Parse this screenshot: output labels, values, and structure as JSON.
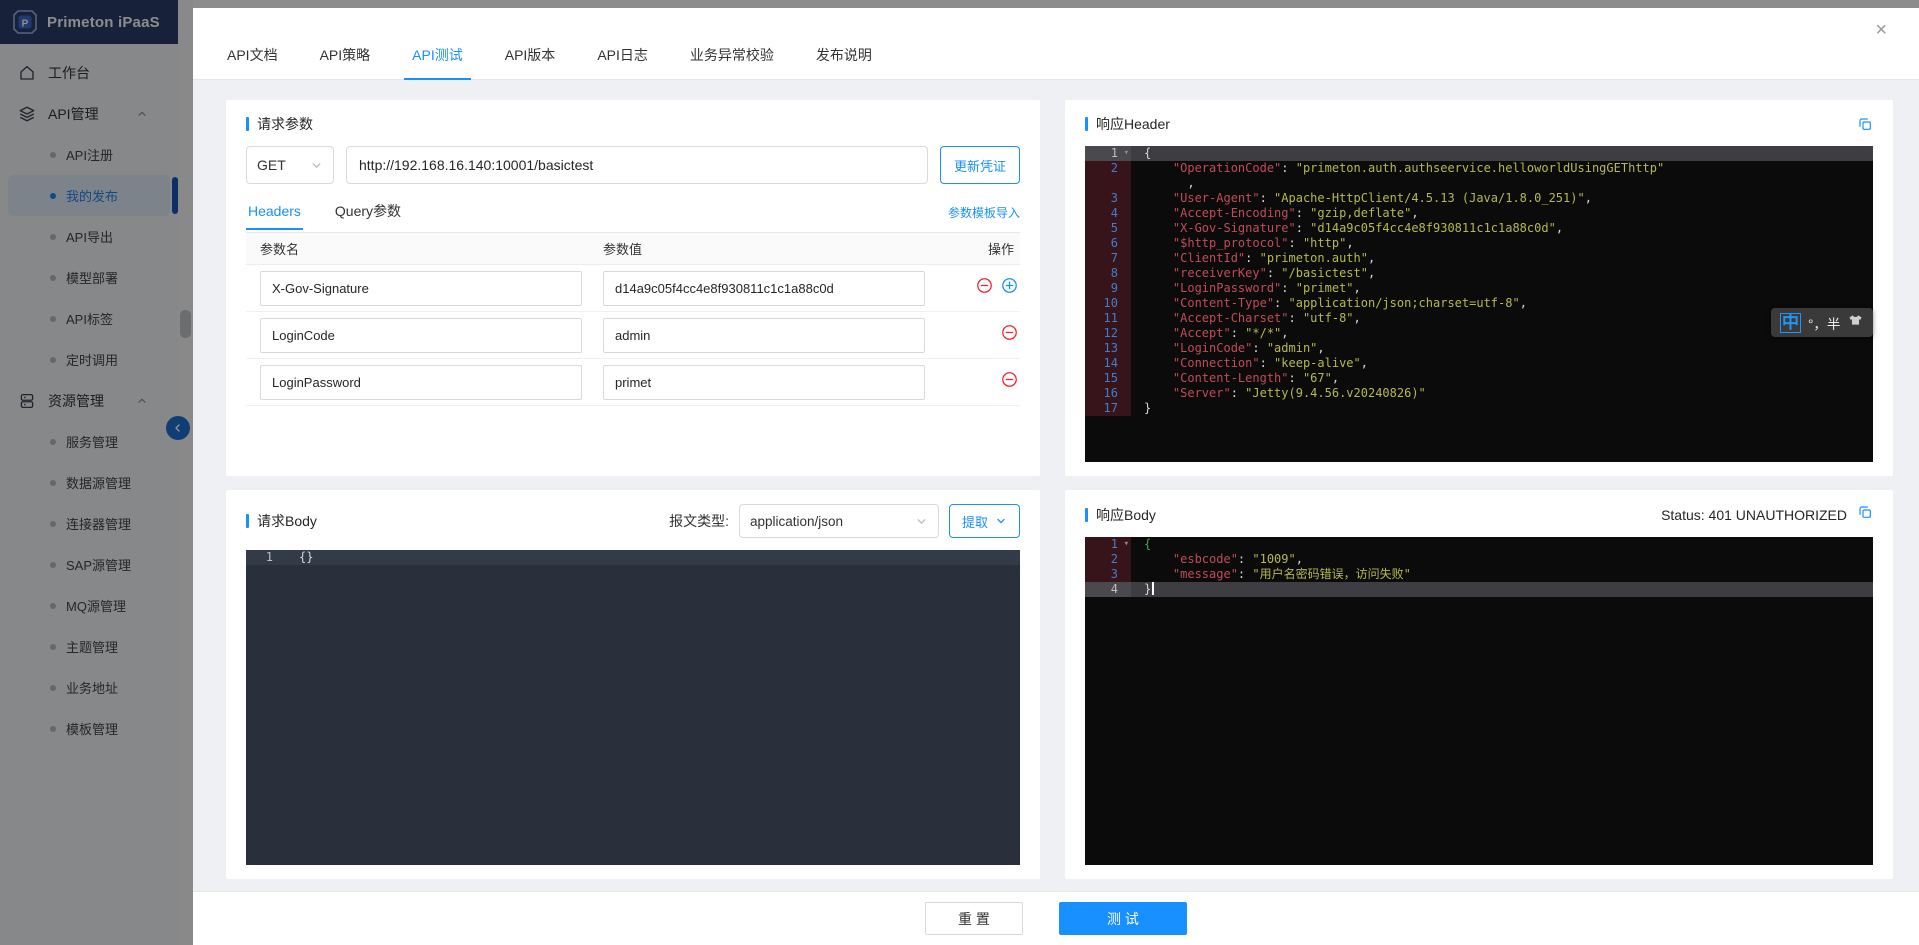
{
  "brand": {
    "name": "Primeton iPaaS"
  },
  "colors": {
    "accent": "#1890ff",
    "danger": "#f5222d",
    "topbar": "#2a3c69",
    "editor_key": "#c24b56",
    "editor_string": "#b5ba4a",
    "editor_line_number": "#3f7ed0",
    "editor_gutter": "#371419",
    "test_button": "#1890ff"
  },
  "sidebar": {
    "items": [
      {
        "type": "group",
        "icon": "home-icon",
        "label": "工作台"
      },
      {
        "type": "group",
        "icon": "layers-icon",
        "label": "API管理",
        "chevron": "up"
      },
      {
        "type": "child",
        "label": "API注册"
      },
      {
        "type": "child",
        "label": "我的发布",
        "active": true
      },
      {
        "type": "child",
        "label": "API导出"
      },
      {
        "type": "child",
        "label": "模型部署"
      },
      {
        "type": "child",
        "label": "API标签"
      },
      {
        "type": "child",
        "label": "定时调用"
      },
      {
        "type": "group",
        "icon": "database-icon",
        "label": "资源管理",
        "chevron": "up"
      },
      {
        "type": "child",
        "label": "服务管理"
      },
      {
        "type": "child",
        "label": "数据源管理"
      },
      {
        "type": "child",
        "label": "连接器管理"
      },
      {
        "type": "child",
        "label": "SAP源管理"
      },
      {
        "type": "child",
        "label": "MQ源管理"
      },
      {
        "type": "child",
        "label": "主题管理"
      },
      {
        "type": "child",
        "label": "业务地址"
      },
      {
        "type": "child",
        "label": "模板管理"
      }
    ]
  },
  "modal": {
    "close": "×",
    "tabs": [
      {
        "label": "API文档"
      },
      {
        "label": "API策略"
      },
      {
        "label": "API测试",
        "active": true
      },
      {
        "label": "API版本"
      },
      {
        "label": "API日志"
      },
      {
        "label": "业务异常校验"
      },
      {
        "label": "发布说明"
      }
    ]
  },
  "request_params": {
    "title": "请求参数",
    "method": "GET",
    "url": "http://192.168.16.140:10001/basictest",
    "update_credential": "更新凭证",
    "tabs": [
      {
        "label": "Headers",
        "active": true
      },
      {
        "label": "Query参数"
      }
    ],
    "template_import": "参数模板导入",
    "table": {
      "columns": [
        "参数名",
        "参数值",
        "操作"
      ],
      "rows": [
        {
          "name": "X-Gov-Signature",
          "value": "d14a9c05f4cc4e8f930811c1c1a88c0d",
          "actions": [
            "remove",
            "add"
          ]
        },
        {
          "name": "LoginCode",
          "value": "admin",
          "actions": [
            "remove"
          ]
        },
        {
          "name": "LoginPassword",
          "value": "primet",
          "actions": [
            "remove"
          ]
        }
      ]
    }
  },
  "response_header": {
    "title": "响应Header",
    "lines": [
      {
        "num": "1",
        "fold": true,
        "active": true,
        "tokens": [
          [
            "p",
            "{"
          ]
        ]
      },
      {
        "num": "2",
        "tokens": [
          [
            "k",
            "    \"OperationCode\""
          ],
          [
            "p",
            ": "
          ],
          [
            "s",
            "\"primeton.auth.authseervice.helloworldUsingGEThttp\""
          ]
        ]
      },
      {
        "num": "",
        "tokens": [
          [
            "p",
            "      ,"
          ]
        ]
      },
      {
        "num": "3",
        "tokens": [
          [
            "k",
            "    \"User-Agent\""
          ],
          [
            "p",
            ": "
          ],
          [
            "s",
            "\"Apache-HttpClient/4.5.13 (Java/1.8.0_251)\""
          ],
          [
            "p",
            ","
          ]
        ]
      },
      {
        "num": "4",
        "tokens": [
          [
            "k",
            "    \"Accept-Encoding\""
          ],
          [
            "p",
            ": "
          ],
          [
            "s",
            "\"gzip,deflate\""
          ],
          [
            "p",
            ","
          ]
        ]
      },
      {
        "num": "5",
        "tokens": [
          [
            "k",
            "    \"X-Gov-Signature\""
          ],
          [
            "p",
            ": "
          ],
          [
            "s",
            "\"d14a9c05f4cc4e8f930811c1c1a88c0d\""
          ],
          [
            "p",
            ","
          ]
        ]
      },
      {
        "num": "6",
        "tokens": [
          [
            "k",
            "    \"$http_protocol\""
          ],
          [
            "p",
            ": "
          ],
          [
            "s",
            "\"http\""
          ],
          [
            "p",
            ","
          ]
        ]
      },
      {
        "num": "7",
        "tokens": [
          [
            "k",
            "    \"ClientId\""
          ],
          [
            "p",
            ": "
          ],
          [
            "s",
            "\"primeton.auth\""
          ],
          [
            "p",
            ","
          ]
        ]
      },
      {
        "num": "8",
        "tokens": [
          [
            "k",
            "    \"receiverKey\""
          ],
          [
            "p",
            ": "
          ],
          [
            "s",
            "\"/basictest\""
          ],
          [
            "p",
            ","
          ]
        ]
      },
      {
        "num": "9",
        "tokens": [
          [
            "k",
            "    \"LoginPassword\""
          ],
          [
            "p",
            ": "
          ],
          [
            "s",
            "\"primet\""
          ],
          [
            "p",
            ","
          ]
        ]
      },
      {
        "num": "10",
        "tokens": [
          [
            "k",
            "    \"Content-Type\""
          ],
          [
            "p",
            ": "
          ],
          [
            "s",
            "\"application/json;charset=utf-8\""
          ],
          [
            "p",
            ","
          ]
        ]
      },
      {
        "num": "11",
        "tokens": [
          [
            "k",
            "    \"Accept-Charset\""
          ],
          [
            "p",
            ": "
          ],
          [
            "s",
            "\"utf-8\""
          ],
          [
            "p",
            ","
          ]
        ]
      },
      {
        "num": "12",
        "tokens": [
          [
            "k",
            "    \"Accept\""
          ],
          [
            "p",
            ": "
          ],
          [
            "s",
            "\"*/*\""
          ],
          [
            "p",
            ","
          ]
        ]
      },
      {
        "num": "13",
        "tokens": [
          [
            "k",
            "    \"LoginCode\""
          ],
          [
            "p",
            ": "
          ],
          [
            "s",
            "\"admin\""
          ],
          [
            "p",
            ","
          ]
        ]
      },
      {
        "num": "14",
        "tokens": [
          [
            "k",
            "    \"Connection\""
          ],
          [
            "p",
            ": "
          ],
          [
            "s",
            "\"keep-alive\""
          ],
          [
            "p",
            ","
          ]
        ]
      },
      {
        "num": "15",
        "tokens": [
          [
            "k",
            "    \"Content-Length\""
          ],
          [
            "p",
            ": "
          ],
          [
            "s",
            "\"67\""
          ],
          [
            "p",
            ","
          ]
        ]
      },
      {
        "num": "16",
        "tokens": [
          [
            "k",
            "    \"Server\""
          ],
          [
            "p",
            ": "
          ],
          [
            "s",
            "\"Jetty(9.4.56.v20240826)\""
          ]
        ]
      },
      {
        "num": "17",
        "tokens": [
          [
            "p",
            "}"
          ]
        ]
      }
    ]
  },
  "request_body": {
    "title": "请求Body",
    "content_type_label": "报文类型:",
    "content_type": "application/json",
    "extract": "提取",
    "lines": [
      {
        "num": "1",
        "active": true,
        "tokens": [
          [
            "p",
            "{}"
          ]
        ]
      }
    ]
  },
  "response_body": {
    "title": "响应Body",
    "status": "Status: 401 UNAUTHORIZED",
    "lines": [
      {
        "num": "1",
        "fold": true,
        "tokens": [
          [
            "g",
            "{"
          ]
        ]
      },
      {
        "num": "2",
        "tokens": [
          [
            "k",
            "    \"esbcode\""
          ],
          [
            "p",
            ": "
          ],
          [
            "s",
            "\"1009\""
          ],
          [
            "p",
            ","
          ]
        ]
      },
      {
        "num": "3",
        "tokens": [
          [
            "k",
            "    \"message\""
          ],
          [
            "p",
            ": "
          ],
          [
            "s",
            "\"用户名密码错误，访问失败\""
          ]
        ]
      },
      {
        "num": "4",
        "active": true,
        "caret": true,
        "tokens": [
          [
            "p",
            "}"
          ]
        ]
      }
    ]
  },
  "footer": {
    "reset": "重 置",
    "test": "测 试"
  },
  "ime": {
    "lang": "中",
    "symbols": "°，半"
  }
}
